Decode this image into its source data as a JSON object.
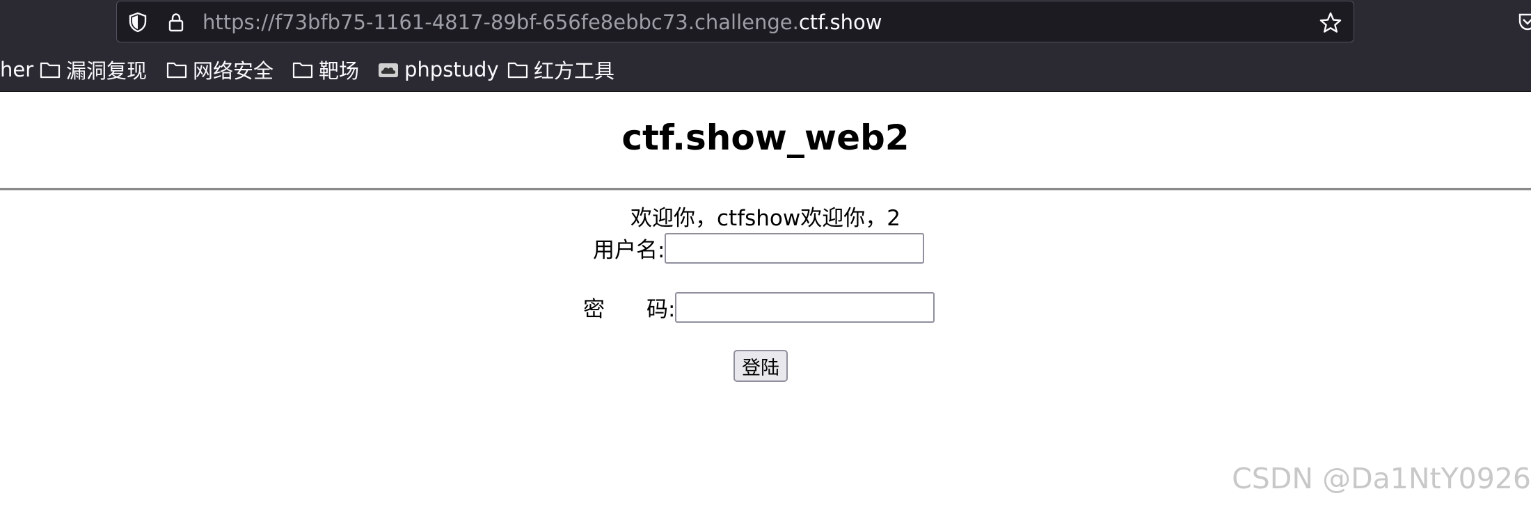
{
  "browser": {
    "url_prefix": "https://f73bfb75-1161-4817-89bf-656fe8ebbc73.challenge.",
    "url_domain": "ctf.show",
    "bookmarks": [
      {
        "label": "her",
        "icon": "none"
      },
      {
        "label": "漏洞复现",
        "icon": "folder-icon"
      },
      {
        "label": "网络安全",
        "icon": "folder-icon"
      },
      {
        "label": "靶场",
        "icon": "folder-icon"
      },
      {
        "label": "phpstudy",
        "icon": "cloud-favicon"
      },
      {
        "label": "红方工具",
        "icon": "folder-icon"
      }
    ],
    "colors": {
      "toolbar": "#2b2a33",
      "urlbar": "#1c1b22",
      "text": "#fbfbfe"
    }
  },
  "page": {
    "title": "ctf.show_web2",
    "welcome": "欢迎你，ctfshow欢迎你，2",
    "username_label": "用户名:",
    "username_value": "",
    "password_label_a": "密",
    "password_label_b": "码:",
    "password_value": "",
    "login_button": "登陆"
  },
  "watermark": "CSDN @Da1NtY0926"
}
